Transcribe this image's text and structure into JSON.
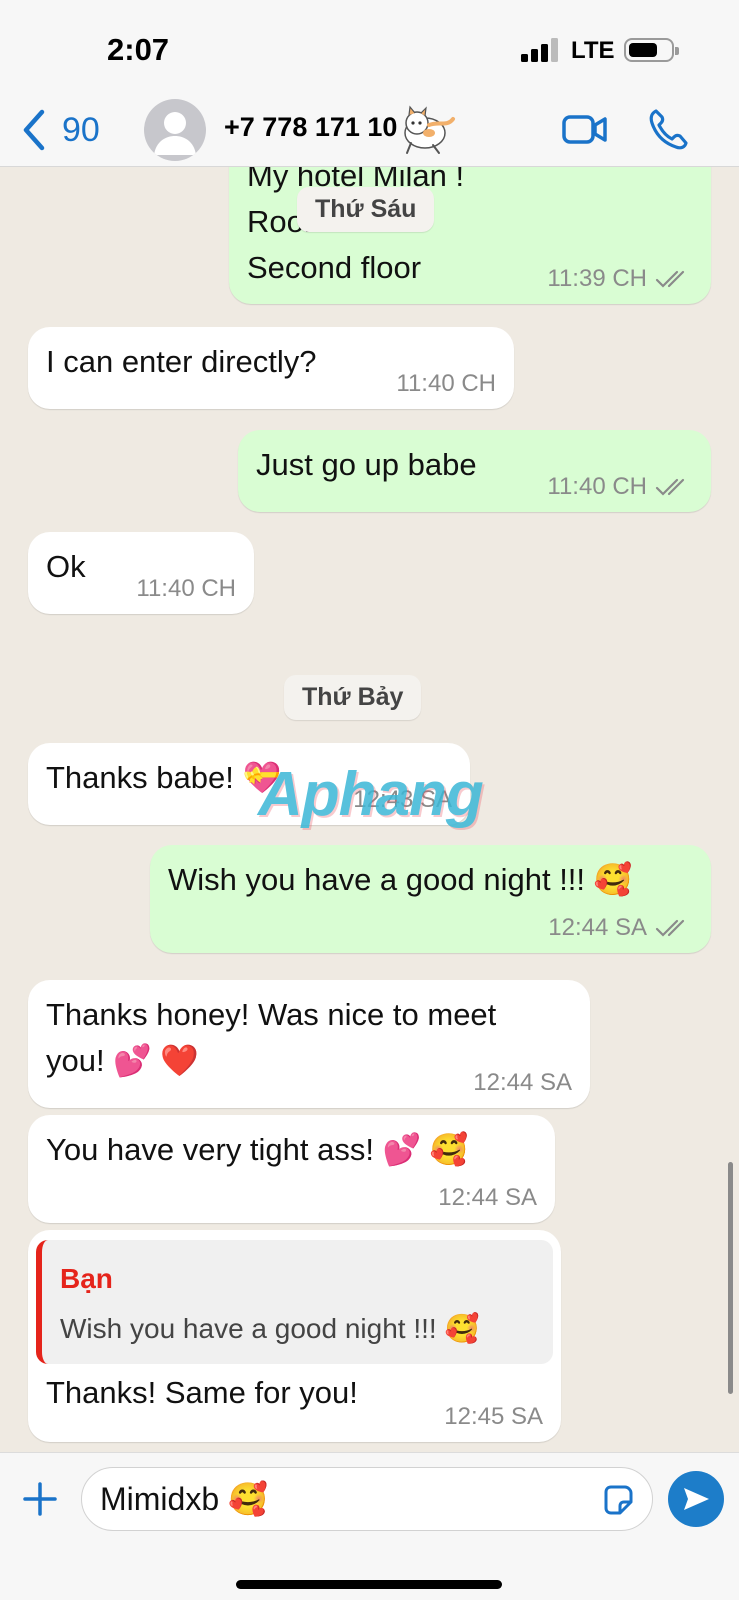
{
  "status_bar": {
    "time": "2:07",
    "network": "LTE"
  },
  "header": {
    "back_count": "90",
    "contact_name": "+7 778 171 10"
  },
  "messages": [
    {
      "direction": "out",
      "lines": [
        "My hotel Milan !",
        "Room",
        "Second floor"
      ],
      "time": "11:39 CH",
      "read": true
    },
    {
      "direction": "in",
      "text": "I can enter directly?",
      "time": "11:40 CH"
    },
    {
      "direction": "out",
      "text": "Just go up babe",
      "time": "11:40 CH",
      "read": true
    },
    {
      "direction": "in",
      "text": "Ok",
      "time": "11:40 CH"
    },
    {
      "direction": "in",
      "text": "Thanks babe! 💝",
      "time": "12:43 SA"
    },
    {
      "direction": "out",
      "text": "Wish you have a good night !!! 🥰",
      "time": "12:44 SA",
      "read": true
    },
    {
      "direction": "in",
      "lines": [
        "Thanks honey! Was nice to meet",
        "you! 💕 ❤️"
      ],
      "time": "12:44 SA"
    },
    {
      "direction": "in",
      "text": "You have very tight ass! 💕 🥰",
      "time": "12:44 SA"
    },
    {
      "direction": "in",
      "quote_author": "Bạn",
      "quote_text": "Wish you have a good night !!! 🥰",
      "text": "Thanks! Same for you!",
      "time": "12:45 SA"
    }
  ],
  "day_chips": {
    "friday": "Thứ Sáu",
    "saturday": "Thứ Bảy"
  },
  "watermark": "Aphang",
  "input": {
    "value": "Mimidxb 🥰"
  },
  "icons": {
    "back": "chevron-left-icon",
    "avatar": "person-icon",
    "video": "video-camera-icon",
    "call": "phone-icon",
    "plus": "plus-icon",
    "sticker": "sticker-icon",
    "send": "send-arrow-icon",
    "ticks": "double-check-icon"
  },
  "colors": {
    "incoming": "#ffffff",
    "outgoing": "#d9fdd3",
    "accent": "#1a73c9",
    "quote_accent": "#e5241b",
    "send": "#1d7dc9",
    "chat_bg": "#efeae2"
  }
}
